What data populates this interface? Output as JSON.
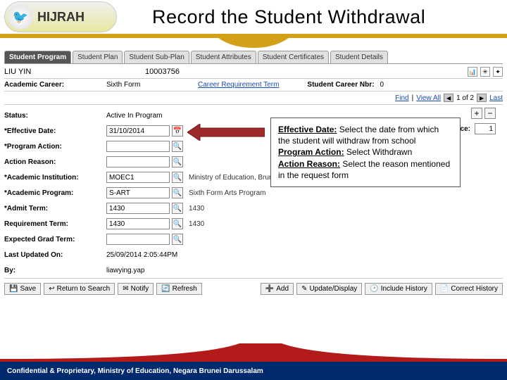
{
  "brand": {
    "logo_label": "HIJRAH",
    "logo_glyph": "🐦"
  },
  "title": "Record the Student Withdrawal",
  "tabs": [
    "Student Program",
    "Student Plan",
    "Student Sub-Plan",
    "Student Attributes",
    "Student Certificates",
    "Student Details"
  ],
  "active_tab": 0,
  "student": {
    "name": "LIU YIN",
    "id": "10003756"
  },
  "career_row": {
    "lbl_career": "Academic Career:",
    "val_career": "Sixth Form",
    "link_req": "Career Requirement Term",
    "lbl_nbr": "Student Career Nbr:",
    "val_nbr": "0"
  },
  "pager": {
    "find": "Find",
    "viewall": "View All",
    "counter": "1 of 2",
    "last": "Last"
  },
  "fields": {
    "status_lbl": "Status:",
    "status_val": "Active In Program",
    "eff_date_lbl": "*Effective Date:",
    "eff_date_val": "31/10/2014",
    "eff_seq_lbl": "Effective Sequence:",
    "eff_seq_val": "1",
    "prog_action_lbl": "*Program Action:",
    "action_reason_lbl": "Action Reason:",
    "inst_lbl": "*Academic Institution:",
    "inst_val": "MOEC1",
    "inst_desc": "Ministry of Education, Brunei",
    "prog_lbl": "*Academic Program:",
    "prog_val": "S-ART",
    "prog_desc": "Sixth Form Arts Program",
    "admit_lbl": "*Admit Term:",
    "admit_val": "1430",
    "admit_desc": "1430",
    "req_lbl": "Requirement Term:",
    "req_val": "1430",
    "req_desc": "1430",
    "grad_lbl": "Expected Grad Term:",
    "upd_lbl": "Last Updated On:",
    "upd_val": "25/09/2014 2:05:44PM",
    "by_lbl": "By:",
    "by_val": "liawying.yap"
  },
  "callout": {
    "p1a": "Effective Date:",
    "p1b": " Select the date from which the student will withdraw from school",
    "p2a": "Program Action:",
    "p2b": " Select Withdrawn",
    "p3a": "Action Reason:",
    "p3b": " Select the reason mentioned in the request form"
  },
  "buttons": {
    "save": "Save",
    "return": "Return to Search",
    "notify": "Notify",
    "refresh": "Refresh",
    "add": "Add",
    "update": "Update/Display",
    "history": "Include History",
    "correct": "Correct History"
  },
  "footer": "Confidential & Proprietary, Ministry of Education, Negara Brunei Darussalam"
}
